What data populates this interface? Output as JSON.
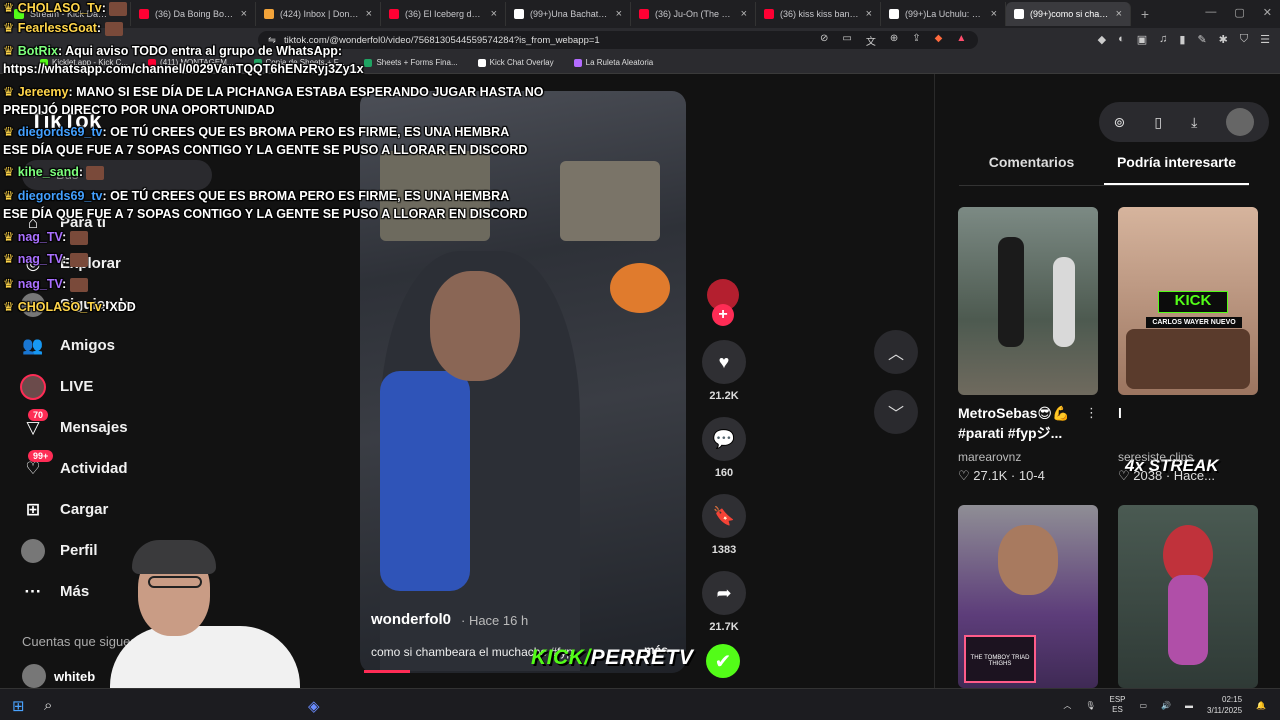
{
  "browser": {
    "tabs": [
      {
        "label": "Stream - Kick Dashboar",
        "color": "#53fc18",
        "active": false
      },
      {
        "label": "(36) Da Boing Boing Trak",
        "color": "#ff0033",
        "active": false
      },
      {
        "label": "(424) Inbox | Donoclip",
        "color": "#f2a33a",
        "active": false
      },
      {
        "label": "(36) El Iceberg de Minecra",
        "color": "#ff0033",
        "active": false
      },
      {
        "label": "(99+)Una Bachata Más: Ag",
        "color": "#ffffff",
        "active": false
      },
      {
        "label": "(36) Ju-On (The Grudge) -",
        "color": "#ff0033",
        "active": false
      },
      {
        "label": "(36) kiss kiss ban bang - Y",
        "color": "#ff0033",
        "active": false
      },
      {
        "label": "(99+)La Uchulu: Baile y Cu",
        "color": "#ffffff",
        "active": false
      },
      {
        "label": "(99+)como si chambe",
        "color": "#ffffff",
        "active": true
      }
    ],
    "new_tab_glyph": "+",
    "url": "tiktok.com/@wonderfol0/video/7568130544559574284?is_from_webapp=1",
    "bookmarks": [
      {
        "label": "Kicklet.app - Kick C...",
        "color": "#53fc18"
      },
      {
        "label": "(411) MONTAGEM...",
        "color": "#ff0033"
      },
      {
        "label": "Copia de Sheets + F...",
        "color": "#1fa463"
      },
      {
        "label": "Sheets + Forms Fina...",
        "color": "#1fa463"
      },
      {
        "label": "Kick Chat Overlay",
        "color": "#ffffff"
      },
      {
        "label": "La Ruleta Aleatoria",
        "color": "#b36bff"
      }
    ]
  },
  "tiktok": {
    "logo": "TikTok",
    "search_placeholder": "Bus",
    "nav": [
      {
        "label": "Para ti",
        "icon": "home-icon",
        "glyph": "⌂"
      },
      {
        "label": "Explorar",
        "icon": "compass-icon",
        "glyph": "◎"
      },
      {
        "label": "Siguiendo",
        "icon": "following-avatar-icon",
        "glyph": ""
      },
      {
        "label": "Amigos",
        "icon": "friends-icon",
        "glyph": "👥"
      },
      {
        "label": "LIVE",
        "icon": "live-avatar-icon",
        "glyph": ""
      },
      {
        "label": "Mensajes",
        "icon": "send-icon",
        "glyph": "▽",
        "badge": "70"
      },
      {
        "label": "Actividad",
        "icon": "inbox-icon",
        "glyph": "♡",
        "badge": "99+"
      },
      {
        "label": "Cargar",
        "icon": "upload-icon",
        "glyph": "⊞"
      },
      {
        "label": "Perfil",
        "icon": "profile-avatar-icon",
        "glyph": ""
      },
      {
        "label": "Más",
        "icon": "more-icon",
        "glyph": "···"
      }
    ],
    "following_title": "Cuentas que sigues",
    "following": [
      {
        "name": "whiteb"
      }
    ],
    "video": {
      "author": "wonderfol0",
      "time": "· Hace 16 h",
      "caption": "como si chambeara el muchacho #fyp",
      "more": "más",
      "progress": 0.14
    },
    "actions": [
      {
        "name": "like",
        "glyph": "♥",
        "count": "21.2K"
      },
      {
        "name": "comment",
        "glyph": "💬",
        "count": "160"
      },
      {
        "name": "bookmark",
        "glyph": "🔖",
        "count": "1383"
      },
      {
        "name": "share",
        "glyph": "➦",
        "count": "21.7K"
      }
    ],
    "panel": {
      "tabs": [
        "Comentarios",
        "Podría interesarte"
      ],
      "active_tab": 1,
      "cards": [
        {
          "title": "MetroSebas😎💪 #parati #fypジ...",
          "author": "marearovnz",
          "likes": "27.1K",
          "date": "10-4"
        },
        {
          "title": "l",
          "author": "seresiste.clips",
          "likes": "2038",
          "date": "Hace..."
        }
      ],
      "overlay_texts": [
        "KICK",
        "CARLOS WAYER NUEVO",
        "4x STREAK",
        "THE TOMBOY TRIAD",
        "THIGHS"
      ]
    }
  },
  "chat": [
    {
      "user": "CHOLASO_Tv",
      "msg": "",
      "color": "gold"
    },
    {
      "user": "FearlessGoat",
      "msg": "",
      "color": "gold"
    },
    {
      "user": "BotRix",
      "msg": "Aqui aviso TODO entra al grupo de WhatsApp:",
      "color": "green"
    },
    {
      "user": "",
      "msg": "https://whatsapp.com/channel/0029VanTQQT6hENzRyj3Zy1x",
      "color": ""
    },
    {
      "user": "Jereemy",
      "msg": "MANO SI ESE DÍA DE LA PICHANGA ESTABA ESPERANDO JUGAR HASTA NO",
      "color": "gold"
    },
    {
      "user": "",
      "msg": "PREDIJÓ DIRECTO POR UNA OPORTUNIDAD",
      "color": ""
    },
    {
      "user": "diegords69_tv",
      "msg": "OE TÚ CREES QUE ES BROMA PERO ES FIRME, ES UNA HEMBRA",
      "color": "blue"
    },
    {
      "user": "",
      "msg": "ESE DÍA QUE FUE A 7 SOPAS CONTIGO Y LA GENTE SE PUSO A LLORAR EN DISCORD",
      "color": ""
    },
    {
      "user": "kihe_sand",
      "msg": "",
      "color": "green"
    },
    {
      "user": "diegords69_tv",
      "msg": "OE TÚ CREES QUE ES BROMA PERO ES FIRME, ES UNA HEMBRA",
      "color": "blue"
    },
    {
      "user": "",
      "msg": "ESE DÍA QUE FUE A 7 SOPAS CONTIGO Y LA GENTE SE PUSO A LLORAR EN DISCORD",
      "color": ""
    },
    {
      "user": "nag_TV",
      "msg": "",
      "color": "purple"
    },
    {
      "user": "nag_TV",
      "msg": "",
      "color": "purple"
    },
    {
      "user": "nag_TV",
      "msg": "",
      "color": "purple"
    },
    {
      "user": "CHOLASO_Tv",
      "msg": "XDD",
      "color": "gold"
    }
  ],
  "overlay": {
    "brand_kick": "KICK/",
    "brand_name": "PERRETV",
    "verified_glyph": "✔"
  },
  "taskbar": {
    "lang_top": "ESP",
    "lang_bottom": "ES",
    "time": "02:15",
    "date": "3/11/2025"
  }
}
